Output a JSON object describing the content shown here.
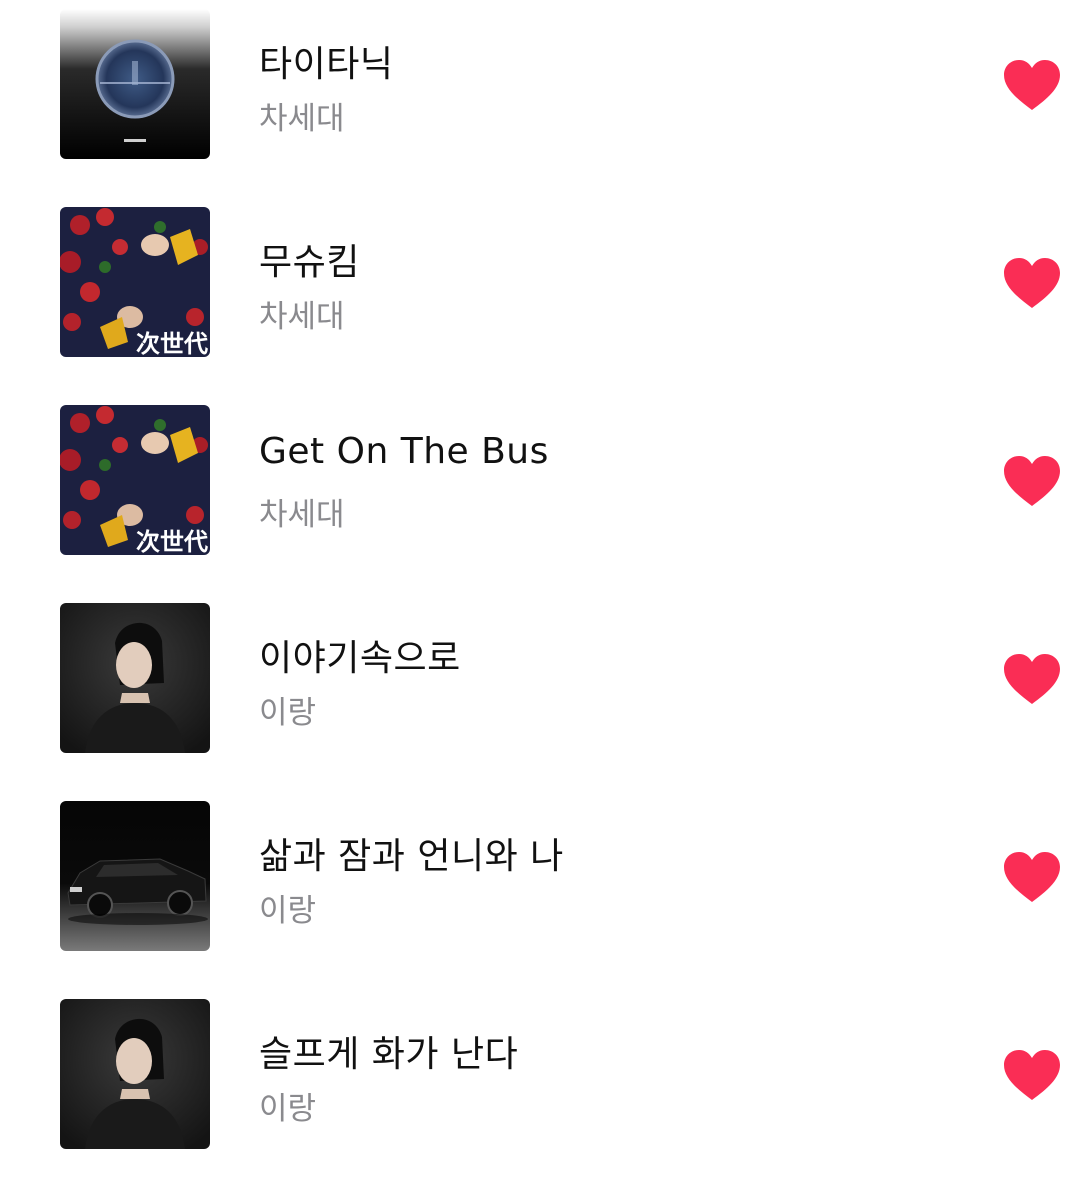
{
  "colors": {
    "heart": "#fa2d55",
    "title": "#111111",
    "artist": "#8a8a8e"
  },
  "songs": [
    {
      "title": "타이타닉",
      "artist": "차세대",
      "artwork": "titanic-porthole",
      "loved": true
    },
    {
      "title": "무슈킴",
      "artist": "차세대",
      "artwork": "roses-band-cover",
      "artwork_text": "次世代",
      "loved": true
    },
    {
      "title": "Get On The Bus",
      "artist": "차세대",
      "artwork": "roses-band-cover",
      "artwork_text": "次世代",
      "loved": true
    },
    {
      "title": "이야기속으로",
      "artist": "이랑",
      "artwork": "woman-portrait",
      "loved": true
    },
    {
      "title": "삶과 잠과 언니와 나",
      "artist": "이랑",
      "artwork": "black-car",
      "loved": true
    },
    {
      "title": "슬프게 화가 난다",
      "artist": "이랑",
      "artwork": "woman-portrait",
      "loved": true
    }
  ]
}
